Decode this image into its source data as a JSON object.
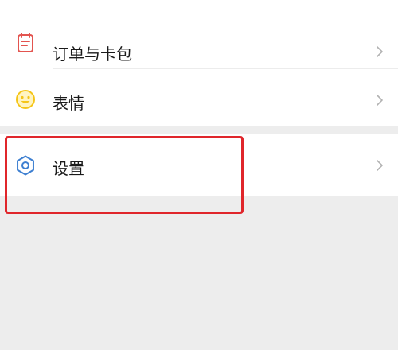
{
  "menu": {
    "items": [
      {
        "label": "订单与卡包",
        "icon": "order-card-icon",
        "icon_color": "#e3544f"
      },
      {
        "label": "表情",
        "icon": "emoji-smile-icon",
        "icon_color": "#f5c518"
      },
      {
        "label": "设置",
        "icon": "gear-icon",
        "icon_color": "#3d7fd1"
      }
    ]
  },
  "highlight": {
    "target": "设置",
    "color": "#e0262b"
  },
  "colors": {
    "background": "#ededed",
    "row": "#ffffff",
    "text": "#1a1a1a",
    "chevron": "#b2b2b2"
  }
}
